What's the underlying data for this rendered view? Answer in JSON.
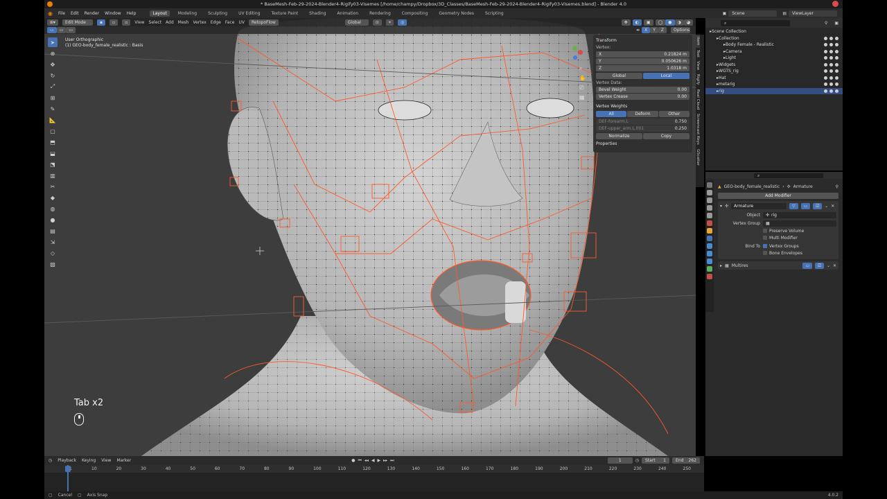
{
  "window": {
    "title": "* BaseMesh-Feb-29-2024-Blender4-Rigify03-Visemes [/home/champy/Dropbox/3D_Classes/BaseMesh-Feb-29-2024-Blender4-Rigify03-Visemes.blend] - Blender 4.0"
  },
  "menus": [
    "File",
    "Edit",
    "Render",
    "Window",
    "Help"
  ],
  "workspaces": [
    "Layout",
    "Modeling",
    "Sculpting",
    "UV Editing",
    "Texture Paint",
    "Shading",
    "Animation",
    "Rendering",
    "Compositing",
    "Geometry Nodes",
    "Scripting"
  ],
  "active_workspace": "Layout",
  "scene": {
    "name": "Scene",
    "view_layer": "ViewLayer"
  },
  "viewport": {
    "mode": "Edit Mode",
    "menus": [
      "View",
      "Select",
      "Add",
      "Mesh",
      "Vertex",
      "Edge",
      "Face",
      "UV"
    ],
    "addon": "RetopoFlow",
    "orientation": "Global",
    "options": "Options",
    "view_name": "User Orthographic",
    "object_info": "(1) GEO-body_female_realistic : Basis",
    "axes": [
      "X",
      "Y",
      "Z"
    ]
  },
  "keycast": {
    "text": "Tab x2",
    "icon": "mouse-icon"
  },
  "npanel": {
    "transform_title": "Transform",
    "vertex_label": "Vertex:",
    "x_label": "X",
    "x_value": "0.21824 m",
    "y_label": "Y",
    "y_value": "0.050626 m",
    "z_label": "Z",
    "z_value": "1.0318 m",
    "global": "Global",
    "local": "Local",
    "vertex_data": "Vertex Data:",
    "bevel_label": "Bevel Weight",
    "bevel_value": "0.00",
    "crease_label": "Vertex Crease",
    "crease_value": "0.00",
    "weights_title": "Vertex Weights",
    "tab_all": "All",
    "tab_deform": "Deform",
    "tab_other": "Other",
    "w1_name": "DEF-forearm.L",
    "w1_value": "0.750",
    "w2_name": "DEF-upper_arm.L.001",
    "w2_value": "0.250",
    "normalize": "Normalize",
    "copy": "Copy",
    "properties": "Properties",
    "tabs": [
      "Item",
      "Tool",
      "View",
      "Rigify",
      "Real Cloud",
      "Screencast Keys",
      "GScatter"
    ]
  },
  "outliner": {
    "rows": [
      {
        "name": "Scene Collection",
        "indent": 0
      },
      {
        "name": "Collection",
        "indent": 1
      },
      {
        "name": "Body Female - Realistic",
        "indent": 2
      },
      {
        "name": "Camera",
        "indent": 2
      },
      {
        "name": "Light",
        "indent": 2
      },
      {
        "name": "Widgets",
        "indent": 1
      },
      {
        "name": "WGTS_rig",
        "indent": 1
      },
      {
        "name": "Hat",
        "indent": 1
      },
      {
        "name": "metarig",
        "indent": 1
      },
      {
        "name": "rig",
        "indent": 1
      }
    ]
  },
  "properties": {
    "breadcrumb_object": "GEO-body_female_realistic",
    "breadcrumb_modifier": "Armature",
    "add_modifier": "Add Modifier",
    "mod1_name": "Armature",
    "object_label": "Object",
    "object_value": "rig",
    "vgroup_label": "Vertex Group",
    "preserve_volume": "Preserve Volume",
    "multi_modifier": "Multi Modifier",
    "bind_to": "Bind To",
    "vertex_groups": "Vertex Groups",
    "bone_envelopes": "Bone Envelopes",
    "mod2_name": "Multires"
  },
  "timeline": {
    "menus": [
      "Playback",
      "Keying",
      "View",
      "Marker"
    ],
    "current_frame": "1",
    "start_label": "Start",
    "start": "1",
    "end_label": "End",
    "end": "262",
    "ticks": [
      "1",
      "10",
      "20",
      "30",
      "40",
      "50",
      "60",
      "70",
      "80",
      "90",
      "100",
      "110",
      "120",
      "130",
      "140",
      "150",
      "160",
      "170",
      "180",
      "190",
      "200",
      "210",
      "220",
      "230",
      "240",
      "250"
    ]
  },
  "status": {
    "left1": "Cancel",
    "left2": "Axis Snap",
    "version": "4.0.2"
  },
  "colors": {
    "accent": "#4772b3",
    "bone": "#ff5a2a",
    "mesh": "#a9a9a9"
  }
}
